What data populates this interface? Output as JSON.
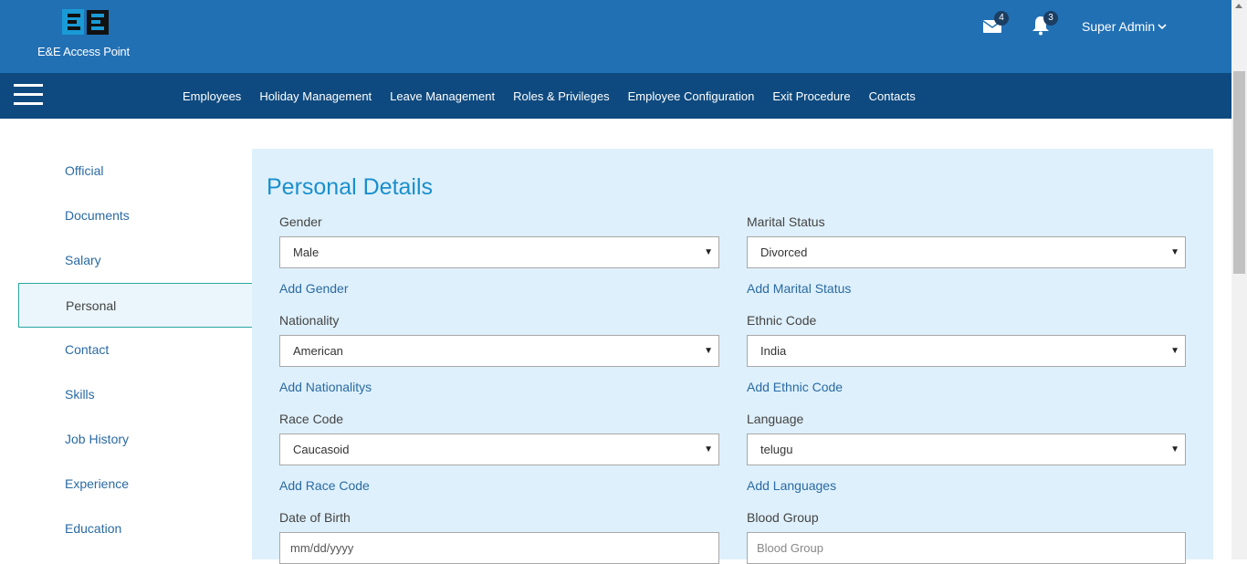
{
  "header": {
    "brand": "E&E Access Point",
    "mail_count": "4",
    "bell_count": "3",
    "user": "Super Admin"
  },
  "nav": [
    "Employees",
    "Holiday Management",
    "Leave Management",
    "Roles & Privileges",
    "Employee Configuration",
    "Exit Procedure",
    "Contacts"
  ],
  "sidebar": [
    "Official",
    "Documents",
    "Salary",
    "Personal",
    "Contact",
    "Skills",
    "Job History",
    "Experience",
    "Education"
  ],
  "form": {
    "title": "Personal Details",
    "gender_label": "Gender",
    "gender_value": "Male",
    "gender_add": "Add Gender",
    "marital_label": "Marital Status",
    "marital_value": "Divorced",
    "marital_add": "Add Marital Status",
    "nationality_label": "Nationality",
    "nationality_value": "American",
    "nationality_add": "Add Nationalitys",
    "ethnic_label": "Ethnic Code",
    "ethnic_value": "India",
    "ethnic_add": "Add Ethnic Code",
    "race_label": "Race Code",
    "race_value": "Caucasoid",
    "race_add": "Add Race Code",
    "language_label": "Language",
    "language_value": "telugu",
    "language_add": "Add Languages",
    "dob_label": "Date of Birth",
    "dob_placeholder": "mm/dd/yyyy",
    "blood_label": "Blood Group",
    "blood_placeholder": "Blood Group"
  }
}
